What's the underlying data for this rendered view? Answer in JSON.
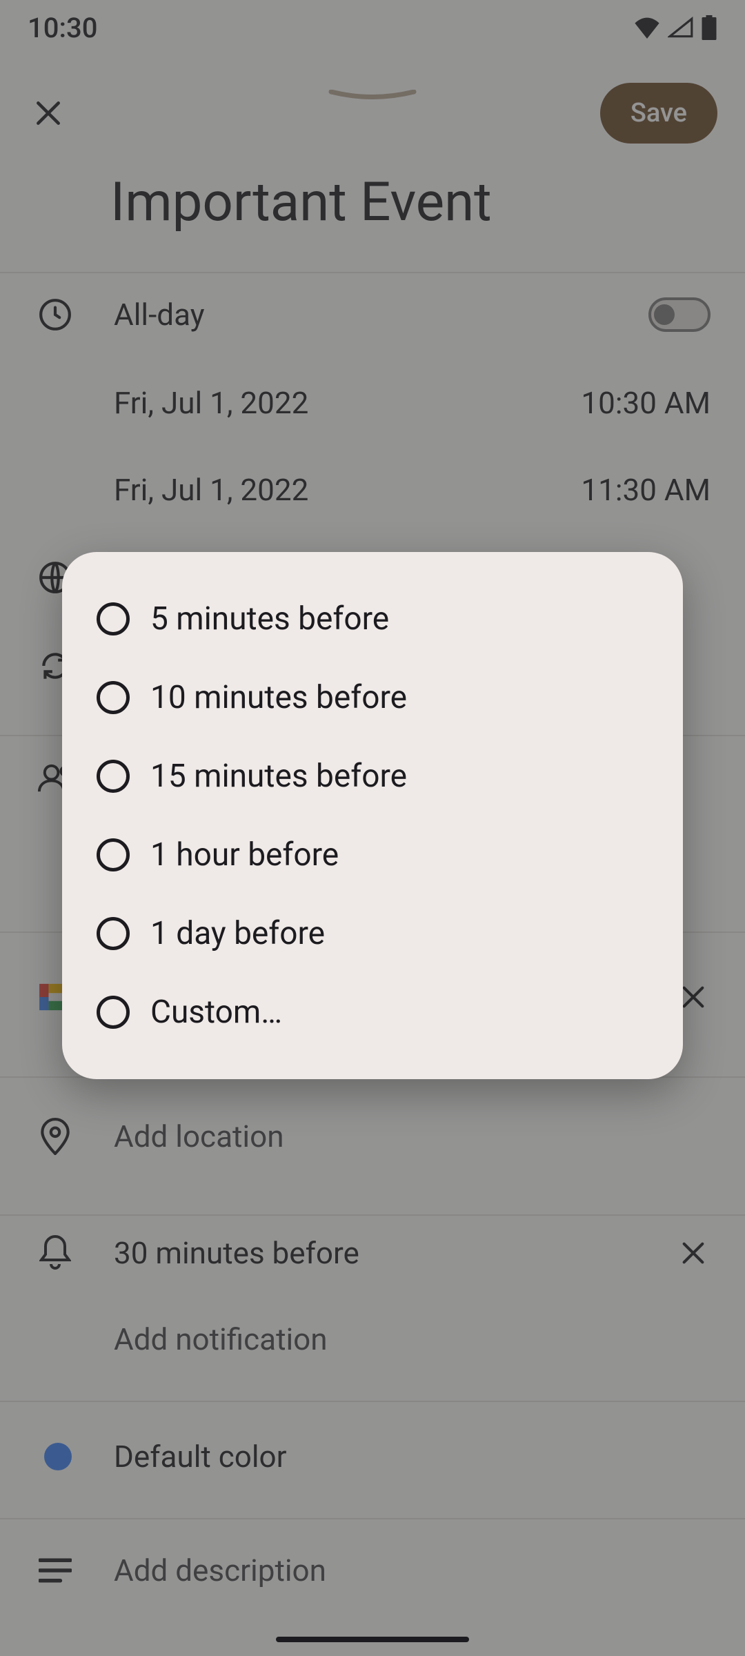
{
  "status": {
    "time": "10:30"
  },
  "header": {
    "save_label": "Save",
    "title": "Important Event"
  },
  "rows": {
    "allday_label": "All-day",
    "start_date": "Fri, Jul 1, 2022",
    "start_time": "10:30 AM",
    "end_date": "Fri, Jul 1, 2022",
    "end_time": "11:30 AM",
    "add_location": "Add location",
    "notification_current": "30 minutes before",
    "add_notification": "Add notification",
    "default_color": "Default color",
    "add_description": "Add description"
  },
  "dialog": {
    "options": [
      "5 minutes before",
      "10 minutes before",
      "15 minutes before",
      "1 hour before",
      "1 day before",
      "Custom…"
    ]
  }
}
